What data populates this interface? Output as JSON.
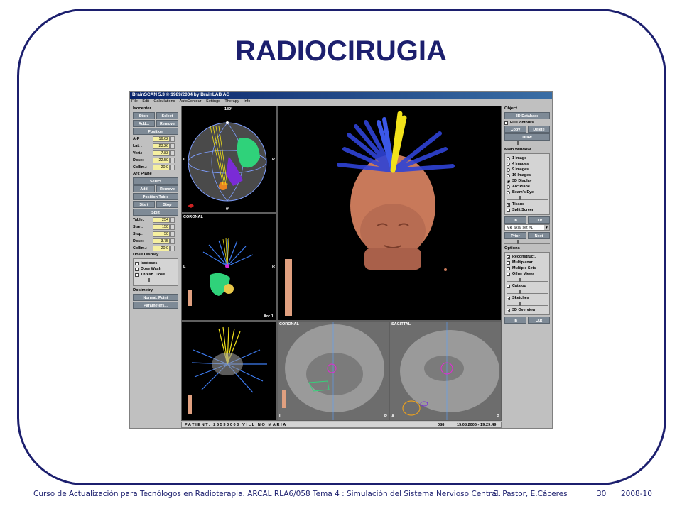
{
  "slide": {
    "title": "RADIOCIRUGIA",
    "footer_course": "Curso de Actualización para Tecnólogos en Radioterapia.  ARCAL RLA6/058  Tema 4 : Simulación del Sistema Nervioso Central.",
    "footer_authors": "E. Pastor,  E.Cáceres",
    "footer_page": "30",
    "footer_year": "2008-10"
  },
  "app": {
    "title": "BrainSCAN 5.3 © 1989/2004 by BrainLAB AG",
    "menu": [
      "File",
      "Edit",
      "Calculations",
      "AutoContour",
      "Settings",
      "Therapy",
      "Info"
    ],
    "left": {
      "isocenter": "Isocenter",
      "store": "Store",
      "select": "Select",
      "add": "Add...",
      "remove": "Remove",
      "position": "Position",
      "fields": [
        {
          "label": "A-P :",
          "value": "16.62"
        },
        {
          "label": "Lat. :",
          "value": "23.26"
        },
        {
          "label": "Vert.:",
          "value": "7.83"
        },
        {
          "label": "Dose:",
          "value": "22.50"
        },
        {
          "label": "Collim.:",
          "value": "20.0"
        }
      ],
      "arc_plane": "Arc Plane",
      "arc_select": "Select",
      "arc_add": "Add",
      "arc_remove": "Remove",
      "position_table": "Position Table",
      "start": "Start",
      "stop": "Stop",
      "split": "Split",
      "split_fields": [
        {
          "label": "Table:",
          "value": "254"
        },
        {
          "label": "Start:",
          "value": "150"
        },
        {
          "label": "Stop:",
          "value": "50"
        },
        {
          "label": "Dose:",
          "value": "3.75"
        },
        {
          "label": "Collim.:",
          "value": "20.0"
        }
      ],
      "dose_display": "Dose Display",
      "dose_options": [
        "Isodoses",
        "Dose Wash",
        "Thresh. Dose"
      ],
      "dosimetry": "Dosimetry",
      "normal_point": "Normal. Point",
      "parameters": "Parameters..."
    },
    "right": {
      "object": "Object",
      "db": "3D Database",
      "fill_contours": "Fill Contours",
      "copy": "Copy",
      "delete": "Delete",
      "draw": "Draw",
      "main_window": "Main Window",
      "views": [
        "1 Image",
        "4 Images",
        "9 Images",
        "16 Images",
        "3D Display",
        "Arc Plane",
        "Beam's Eye"
      ],
      "selected_view": 4,
      "tissue": "Tissue",
      "split_screen": "Split Screen",
      "in": "In",
      "out": "Out",
      "mr_set": "MR axial set #1",
      "prior": "Prior",
      "next": "Next",
      "options": "Options",
      "options_list": [
        {
          "label": "Reconstruct.",
          "checked": true
        },
        {
          "label": "Multiplanar",
          "checked": false
        },
        {
          "label": "Multiple Sets",
          "checked": false
        },
        {
          "label": "Other Views",
          "checked": false
        }
      ],
      "catalog": "Catalog",
      "sketches": "Sketches",
      "overview": "3D Overview",
      "in2": "In",
      "out2": "Out"
    },
    "views": {
      "top_angle": "180°",
      "bottom_angle": "0°",
      "coronal_small": "CORONAL",
      "arc_label": "Arc 1",
      "coronal": "CORONAL",
      "sagittal": "SAGITTAL",
      "l": "L",
      "r": "R",
      "a": "A",
      "p": "P"
    },
    "status": {
      "patient": "PATIENT: 25530000 VILLINO MARIA",
      "code": "088",
      "date": "15.08.2006 - 19:29:49"
    }
  }
}
